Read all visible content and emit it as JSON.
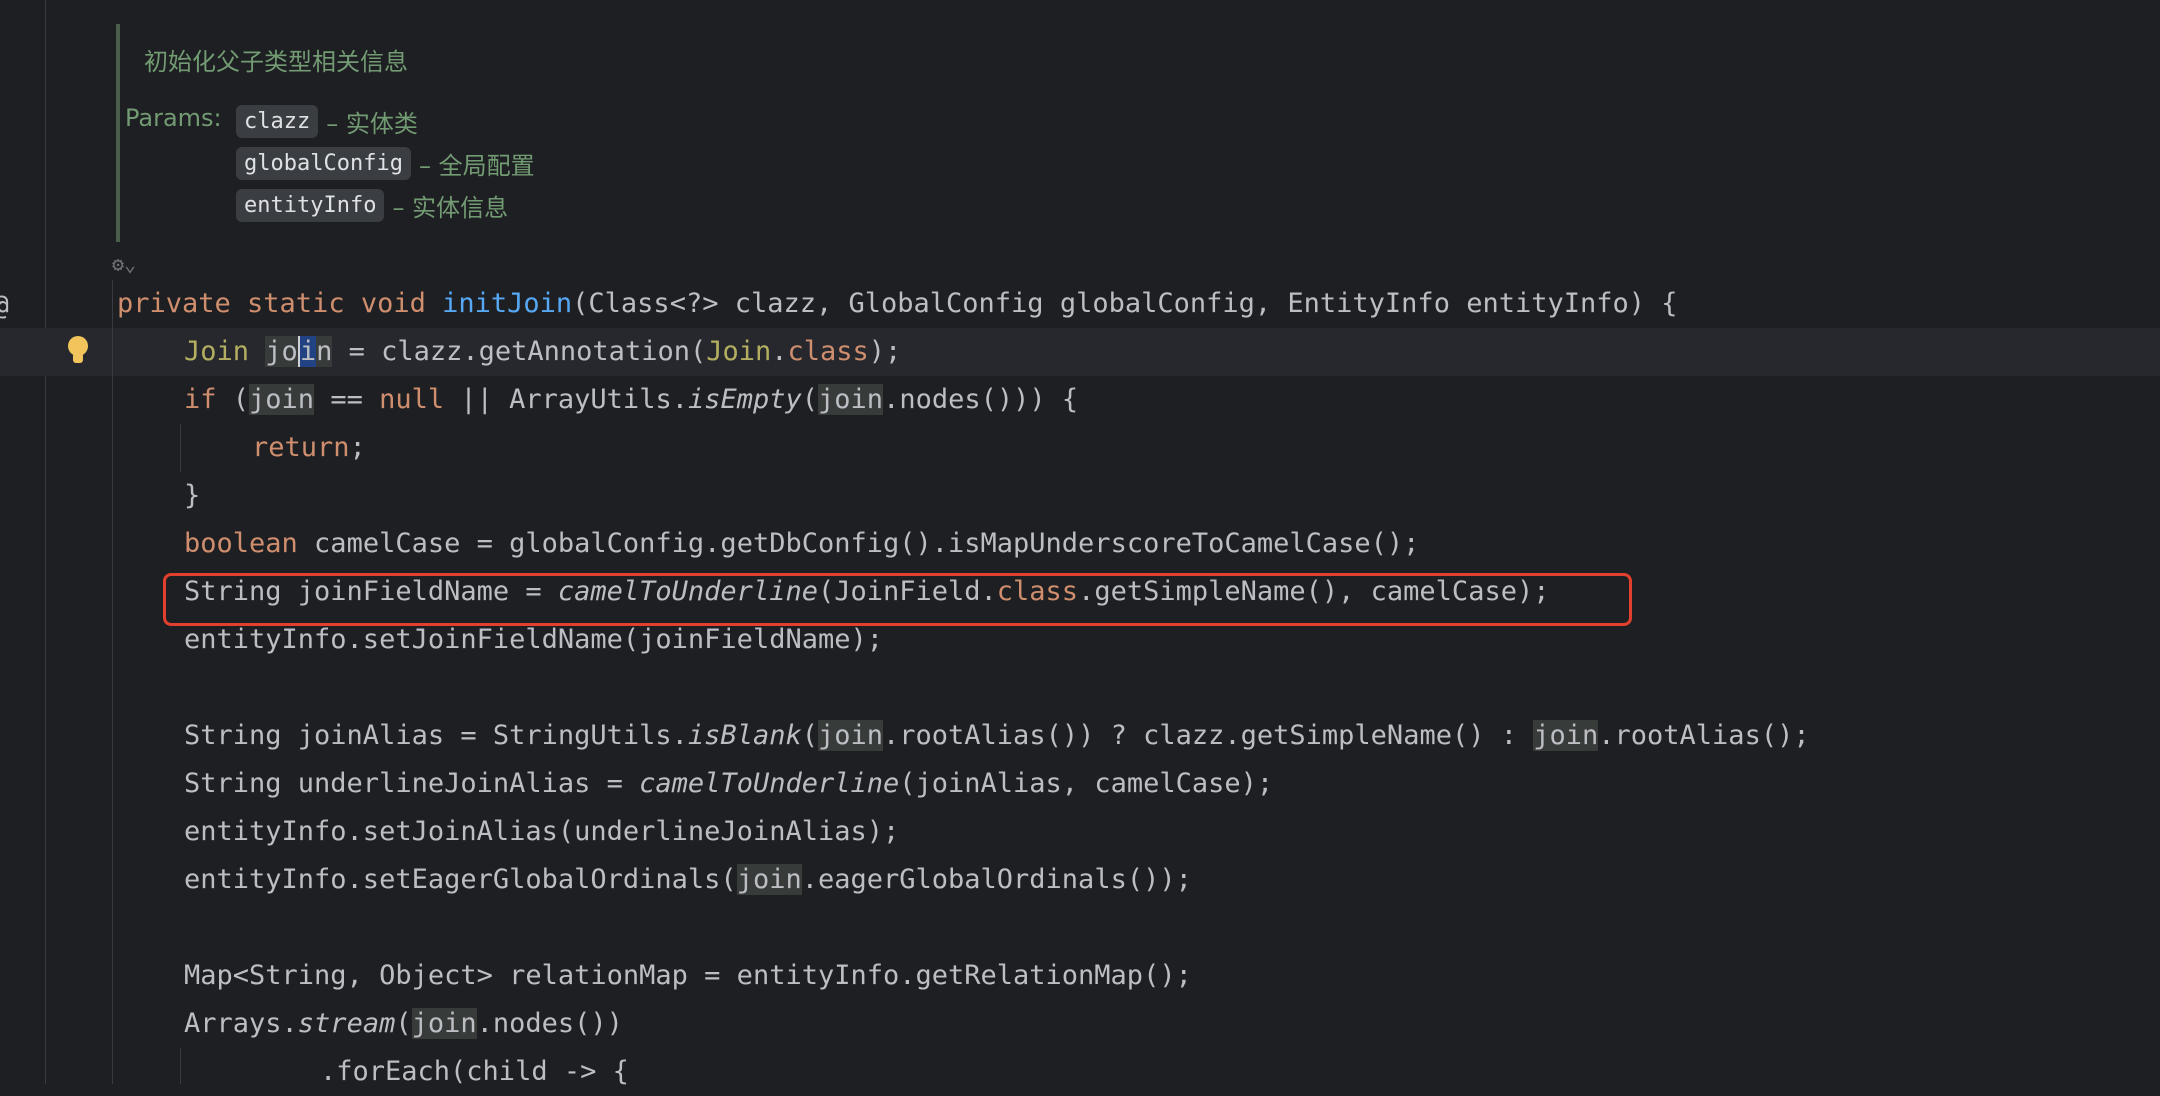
{
  "doc": {
    "summary": "初始化父子类型相关信息",
    "params_label": "Params:",
    "params": [
      {
        "name": "clazz",
        "desc": "– 实体类"
      },
      {
        "name": "globalConfig",
        "desc": "– 全局配置"
      },
      {
        "name": "entityInfo",
        "desc": "– 实体信息"
      }
    ]
  },
  "code": {
    "signature": {
      "mods": "private static void ",
      "name": "initJoin",
      "rest": "(Class<?> clazz, GlobalConfig globalConfig, EntityInfo entityInfo) {"
    },
    "l1": {
      "type": "Join",
      "sp1": " ",
      "v1": "jo",
      "v2": "i",
      "v3": "n",
      "mid": " = clazz.getAnnotation(",
      "cls": "Join",
      "dot": ".",
      "kw": "class",
      "end": ");"
    },
    "l2": {
      "kw": "if",
      "p1": " (",
      "v": "join",
      "op": " == ",
      "nul": "null",
      "p2": " || ArrayUtils.",
      "m": "isEmpty",
      "p3": "(",
      "v2": "join",
      "p4": ".nodes())) {"
    },
    "l3": {
      "kw": "return",
      "end": ";"
    },
    "l4": "}",
    "l5": {
      "kw": "boolean",
      "rest": " camelCase = globalConfig.getDbConfig().isMapUnderscoreToCamelCase();"
    },
    "l6": {
      "a": "String joinFieldName = ",
      "m": "camelToUnderline",
      "b": "(JoinField.",
      "kw": "class",
      "c": ".getSimpleName(), camelCase);"
    },
    "l7": "entityInfo.setJoinFieldName(joinFieldName);",
    "l8": {
      "a": "String joinAlias = StringUtils.",
      "m": "isBlank",
      "b": "(",
      "v": "join",
      "c": ".rootAlias()) ? clazz.getSimpleName() : ",
      "v2": "join",
      "d": ".rootAlias();"
    },
    "l9": {
      "a": "String underlineJoinAlias = ",
      "m": "camelToUnderline",
      "b": "(joinAlias, camelCase);"
    },
    "l10": "entityInfo.setJoinAlias(underlineJoinAlias);",
    "l11": {
      "a": "entityInfo.setEagerGlobalOrdinals(",
      "v": "join",
      "b": ".eagerGlobalOrdinals());"
    },
    "l12": "Map<String, Object> relationMap = entityInfo.getRelationMap();",
    "l13": {
      "a": "Arrays.",
      "m": "stream",
      "b": "(",
      "v": "join",
      "c": ".nodes())"
    },
    "l14": ".forEach(child -> {"
  },
  "gutter": {
    "bulb_icon": "lightbulb-icon",
    "inlay_text": "⚙⌄",
    "at_text": "@"
  },
  "colors": {
    "background": "#1e1f22",
    "keyword": "#cf8e6d",
    "function": "#56a8f5",
    "annotation": "#b3ae60",
    "highlight_box": "#e0402d"
  }
}
